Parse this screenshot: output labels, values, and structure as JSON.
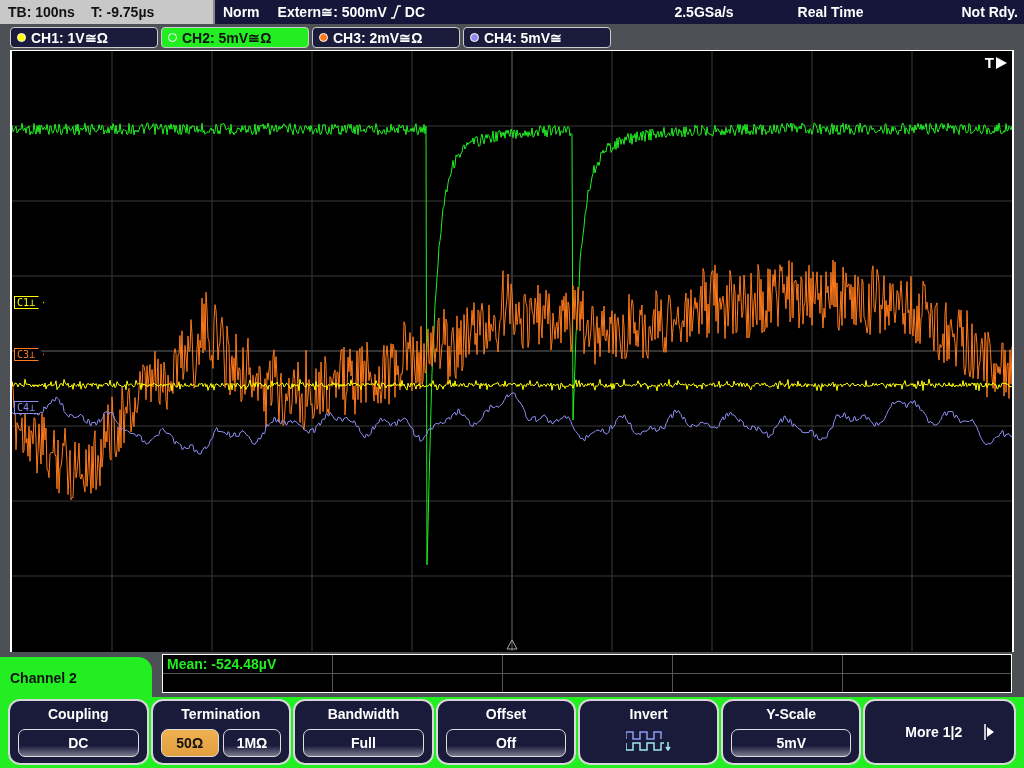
{
  "top_bar": {
    "timebase": "TB: 100ns",
    "trigger_time": "T: -9.75µs",
    "mode": "Norm",
    "trigger_source": "Extern≅: 500mV",
    "trigger_coupling": "DC",
    "sample_rate": "2.5GSa/s",
    "acquisition": "Real Time",
    "status": "Not Rdy."
  },
  "channels": [
    {
      "label": "CH1: 1V≅Ω",
      "color": "#ffff00",
      "selected": false
    },
    {
      "label": "CH2: 5mV≅Ω",
      "color": "#22ee22",
      "selected": true
    },
    {
      "label": "CH3: 2mV≅Ω",
      "color": "#ff7a1a",
      "selected": false
    },
    {
      "label": "CH4: 5mV≅",
      "color": "#8c8cf0",
      "selected": false
    }
  ],
  "plot": {
    "trigger_label": "T",
    "markers": [
      {
        "label": "C1⊥",
        "color": "#ffff00"
      },
      {
        "label": "C3⊥",
        "color": "#ff7a1a"
      },
      {
        "label": "C4⊥",
        "color": "#8c8cf0"
      }
    ]
  },
  "menu": {
    "title": "Channel 2"
  },
  "measurement": {
    "text": "Mean: -524.48µV"
  },
  "softkeys": [
    {
      "kind": "value",
      "label": "Coupling",
      "value": "DC"
    },
    {
      "kind": "options",
      "label": "Termination",
      "options": [
        {
          "label": "50Ω",
          "selected": true
        },
        {
          "label": "1MΩ",
          "selected": false
        }
      ]
    },
    {
      "kind": "value",
      "label": "Bandwidth",
      "value": "Full"
    },
    {
      "kind": "value",
      "label": "Offset",
      "value": "Off"
    },
    {
      "kind": "icon",
      "label": "Invert"
    },
    {
      "kind": "value",
      "label": "Y-Scale",
      "value": "5mV"
    },
    {
      "kind": "more",
      "label": "More 1|2"
    }
  ]
}
